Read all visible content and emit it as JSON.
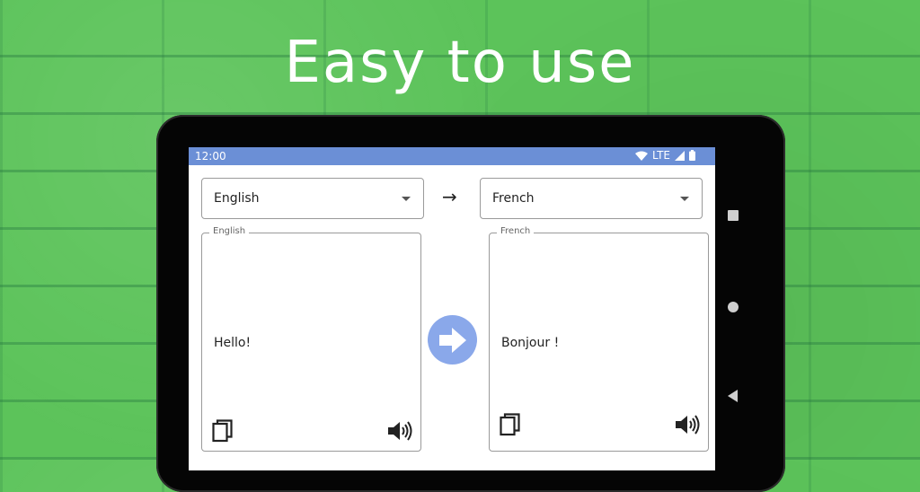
{
  "headline": "Easy to use",
  "status_bar": {
    "time": "12:00",
    "network": "LTE"
  },
  "source_language": {
    "selected": "English"
  },
  "target_language": {
    "selected": "French"
  },
  "swap_arrow": "→",
  "source_box": {
    "legend": "English",
    "text": "Hello!"
  },
  "target_box": {
    "legend": "French",
    "text": "Bonjour !"
  },
  "colors": {
    "background_green": "#5cc35a",
    "status_bar": "#6b8fd6",
    "translate_button": "#8aa8ea",
    "tablet_frame": "#050505"
  },
  "icons": {
    "copy": "copy-icon",
    "speaker": "speaker-icon",
    "translate": "arrow-right-icon",
    "wifi": "wifi-icon",
    "signal": "signal-icon",
    "battery": "battery-icon",
    "nav_square": "recents-icon",
    "nav_circle": "home-icon",
    "nav_triangle": "back-icon"
  }
}
